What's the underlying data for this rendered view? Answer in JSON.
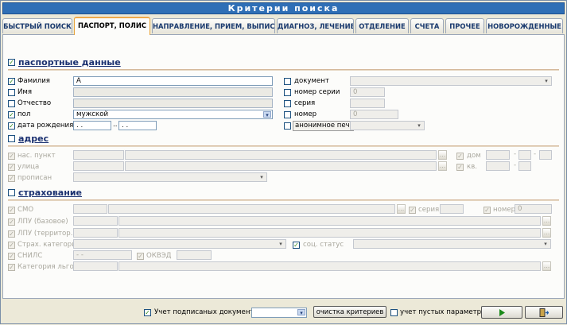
{
  "window": {
    "title": "Критерии поиска"
  },
  "tabs": [
    {
      "label": "БЫСТРЫЙ ПОИСК",
      "active": false
    },
    {
      "label": "ПАСПОРТ, ПОЛИС",
      "active": true
    },
    {
      "label": "НАПРАВЛЕНИЕ, ПРИЕМ, ВЫПИСКА",
      "active": false
    },
    {
      "label": "ДИАГНОЗ, ЛЕЧЕНИЕ",
      "active": false
    },
    {
      "label": "ОТДЕЛЕНИЕ",
      "active": false
    },
    {
      "label": "СЧЕТА",
      "active": false
    },
    {
      "label": "ПРОЧЕЕ",
      "active": false
    },
    {
      "label": "НОВОРОЖДЕННЫЕ",
      "active": false
    }
  ],
  "passport": {
    "section": "паспортные данные",
    "surname": {
      "label": "Фамилия",
      "value": "А"
    },
    "name": {
      "label": "Имя"
    },
    "patronymic": {
      "label": "Отчество"
    },
    "sex": {
      "label": "пол",
      "value": "мужской"
    },
    "birthdate": {
      "label": "дата рождения",
      "from": ". .",
      "sep": "..",
      "to": ". ."
    },
    "document": {
      "label": "документ"
    },
    "series_number": {
      "label": "номер серии",
      "value": "0"
    },
    "series": {
      "label": "серия"
    },
    "number": {
      "label": "номер",
      "value": "0"
    },
    "anonymous": {
      "label": "анонимное печ."
    }
  },
  "address": {
    "section": "адрес",
    "locality": {
      "label": "нас. пункт"
    },
    "street": {
      "label": "улица"
    },
    "registered": {
      "label": "прописан"
    },
    "house": {
      "label": "дом",
      "dash": "-"
    },
    "apartment": {
      "label": "кв.",
      "dash": "-"
    }
  },
  "insurance": {
    "section": "страхование",
    "smo": {
      "label": "СМО"
    },
    "lpu_base": {
      "label": "ЛПУ (базовое)"
    },
    "lpu_territorial": {
      "label": "ЛПУ (территор.)"
    },
    "category": {
      "label": "Страх. категория"
    },
    "social_status": {
      "label": "соц. статус"
    },
    "snils": {
      "label": "СНИЛС",
      "value": "- -"
    },
    "okved": {
      "label": "ОКВЭД"
    },
    "benefit": {
      "label": "Категория льготы"
    },
    "series": {
      "label": "серия"
    },
    "number": {
      "label": "номер",
      "value": "0"
    }
  },
  "footer": {
    "signed_docs": "Учет подписаных документов",
    "clear": "очистка критериев",
    "empty_params": "учет пустых параметров",
    "run_icon": "play-arrow",
    "exit_icon": "exit-door"
  },
  "icons": {
    "checked": "✓",
    "dropdown": "▾",
    "ellipsis": "..."
  },
  "colors": {
    "title": "#2f6fb6",
    "active_tab_border": "#f0a94a",
    "section": "#1a3070"
  }
}
